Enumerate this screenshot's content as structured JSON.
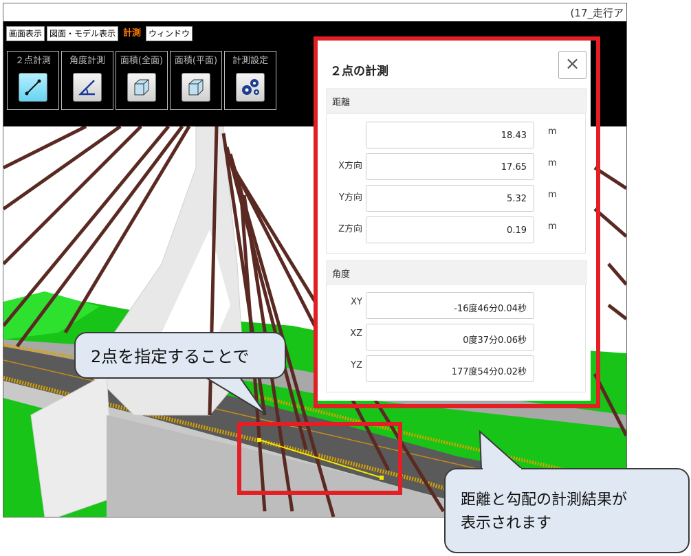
{
  "window": {
    "title": "(17_走行ア"
  },
  "menu": [
    "画面表示",
    "図面・モデル表示",
    "計測",
    "ウィンドウ"
  ],
  "menu_active_index": 2,
  "tools": [
    {
      "label": "２点計測",
      "icon": "line-measure-icon"
    },
    {
      "label": "角度計測",
      "icon": "angle-icon"
    },
    {
      "label": "面積(全面)",
      "icon": "cube-icon"
    },
    {
      "label": "面積(平面)",
      "icon": "cube-icon"
    },
    {
      "label": "計測設定",
      "icon": "gears-icon"
    }
  ],
  "panel": {
    "title": "２点の計測",
    "close_label": "×",
    "distance": {
      "heading": "距離",
      "rows": [
        {
          "label": "",
          "value": "18.43",
          "unit": "m"
        },
        {
          "label": "X方向",
          "value": "17.65",
          "unit": "m"
        },
        {
          "label": "Y方向",
          "value": "5.32",
          "unit": "m"
        },
        {
          "label": "Z方向",
          "value": "0.19",
          "unit": "m"
        }
      ]
    },
    "angle": {
      "heading": "角度",
      "rows": [
        {
          "label": "XY",
          "value": "-16度46分0.04秒"
        },
        {
          "label": "XZ",
          "value": "0度37分0.06秒"
        },
        {
          "label": "YZ",
          "value": "177度54分0.02秒"
        }
      ]
    }
  },
  "callouts": {
    "first": "2点を指定することで",
    "second": "距離と勾配の計測結果が\n表示されます"
  },
  "colors": {
    "highlight": "#e31e24",
    "callout_fill": "#dfe8f3",
    "active_menu": "#ff7a00",
    "sky": "#ffffff",
    "grass": "#1ecf1e",
    "cables": "#5a2a22"
  }
}
